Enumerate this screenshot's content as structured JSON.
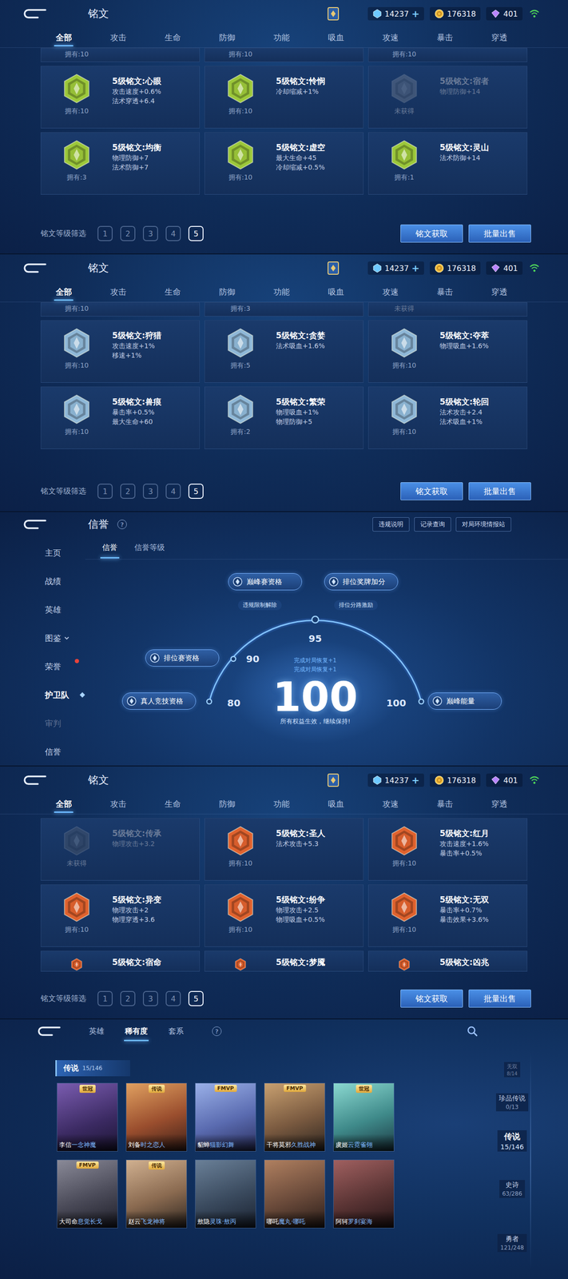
{
  "inscription_screen": {
    "title": "铭文",
    "currencies": [
      {
        "kind": "diamond",
        "value": "14237",
        "add": "+"
      },
      {
        "kind": "coin",
        "value": "176318"
      },
      {
        "kind": "gem",
        "value": "401"
      }
    ],
    "tabs": [
      {
        "label": "全部",
        "selected": true
      },
      {
        "label": "攻击",
        "selected": false
      },
      {
        "label": "生命",
        "selected": false
      },
      {
        "label": "防御",
        "selected": false
      },
      {
        "label": "功能",
        "selected": false
      },
      {
        "label": "吸血",
        "selected": false
      },
      {
        "label": "攻速",
        "selected": false
      },
      {
        "label": "暴击",
        "selected": false
      },
      {
        "label": "穿透",
        "selected": false
      }
    ],
    "filter_label": "铭文等级筛选",
    "levels": [
      {
        "label": "1",
        "selected": false
      },
      {
        "label": "2",
        "selected": false
      },
      {
        "label": "3",
        "selected": false
      },
      {
        "label": "4",
        "selected": false
      },
      {
        "label": "5",
        "selected": true
      }
    ],
    "buttons": [
      "铭文获取",
      "批量出售"
    ]
  },
  "inscription_pages": [
    {
      "rows": [
        {
          "kind": "cut-top",
          "cards": [
            {
              "owned": true,
              "owned_text": "拥有:10"
            },
            {
              "owned": true,
              "owned_text": "拥有:10"
            },
            {
              "owned": true,
              "owned_text": "拥有:10"
            }
          ]
        },
        {
          "kind": "full",
          "cards": [
            {
              "name": "5级铭文:心眼",
              "stats": [
                "攻击速度+0.6%",
                "法术穿透+6.4"
              ],
              "owned": true,
              "owned_text": "拥有:10",
              "color": "#9cc83a"
            },
            {
              "name": "5级铭文:怜悯",
              "stats": [
                "冷却缩减+1%"
              ],
              "owned": true,
              "owned_text": "拥有:10",
              "color": "#9cc83a"
            },
            {
              "name": "5级铭文:宿者",
              "stats": [
                "物理防御+14"
              ],
              "owned": false,
              "owned_text": "未获得",
              "color": "#9cc83a"
            }
          ]
        },
        {
          "kind": "full",
          "cards": [
            {
              "name": "5级铭文:均衡",
              "stats": [
                "物理防御+7",
                "法术防御+7"
              ],
              "owned": true,
              "owned_text": "拥有:3",
              "color": "#9cc83a"
            },
            {
              "name": "5级铭文:虚空",
              "stats": [
                "最大生命+45",
                "冷却缩减+0.5%"
              ],
              "owned": true,
              "owned_text": "拥有:10",
              "color": "#9cc83a"
            },
            {
              "name": "5级铭文:灵山",
              "stats": [
                "法术防御+14"
              ],
              "owned": true,
              "owned_text": "拥有:1",
              "color": "#9cc83a"
            }
          ]
        }
      ]
    },
    {
      "rows": [
        {
          "kind": "cut-top",
          "cards": [
            {
              "owned": true,
              "owned_text": "拥有:10"
            },
            {
              "owned": true,
              "owned_text": "拥有:3"
            },
            {
              "owned": false,
              "owned_text": "未获得"
            }
          ]
        },
        {
          "kind": "full",
          "cards": [
            {
              "name": "5级铭文:狩猎",
              "stats": [
                "攻击速度+1%",
                "移速+1%"
              ],
              "owned": true,
              "owned_text": "拥有:10",
              "color": "#8fb8d8"
            },
            {
              "name": "5级铭文:贪婪",
              "stats": [
                "法术吸血+1.6%"
              ],
              "owned": true,
              "owned_text": "拥有:5",
              "color": "#8fb8d8"
            },
            {
              "name": "5级铭文:夺萃",
              "stats": [
                "物理吸血+1.6%"
              ],
              "owned": true,
              "owned_text": "拥有:10",
              "color": "#8fb8d8"
            }
          ]
        },
        {
          "kind": "full",
          "cards": [
            {
              "name": "5级铭文:兽痕",
              "stats": [
                "暴击率+0.5%",
                "最大生命+60"
              ],
              "owned": true,
              "owned_text": "拥有:10",
              "color": "#8fb8d8"
            },
            {
              "name": "5级铭文:繁荣",
              "stats": [
                "物理吸血+1%",
                "物理防御+5"
              ],
              "owned": true,
              "owned_text": "拥有:2",
              "color": "#8fb8d8"
            },
            {
              "name": "5级铭文:轮回",
              "stats": [
                "法术攻击+2.4",
                "法术吸血+1%"
              ],
              "owned": true,
              "owned_text": "拥有:10",
              "color": "#8fb8d8"
            }
          ]
        }
      ]
    },
    {
      "rows": [
        {
          "kind": "full",
          "cards": [
            {
              "name": "5级铭文:传承",
              "stats": [
                "物理攻击+3.2"
              ],
              "owned": false,
              "owned_text": "未获得",
              "color": "#e0622e"
            },
            {
              "name": "5级铭文:圣人",
              "stats": [
                "法术攻击+5.3"
              ],
              "owned": true,
              "owned_text": "拥有:10",
              "color": "#e0622e"
            },
            {
              "name": "5级铭文:红月",
              "stats": [
                "攻击速度+1.6%",
                "暴击率+0.5%"
              ],
              "owned": true,
              "owned_text": "拥有:10",
              "color": "#e0622e"
            }
          ]
        },
        {
          "kind": "full",
          "cards": [
            {
              "name": "5级铭文:异变",
              "stats": [
                "物理攻击+2",
                "物理穿透+3.6"
              ],
              "owned": true,
              "owned_text": "拥有:10",
              "color": "#e0622e"
            },
            {
              "name": "5级铭文:纷争",
              "stats": [
                "物理攻击+2.5",
                "物理吸血+0.5%"
              ],
              "owned": true,
              "owned_text": "拥有:10",
              "color": "#e0622e"
            },
            {
              "name": "5级铭文:无双",
              "stats": [
                "暴击率+0.7%",
                "暴击效果+3.6%"
              ],
              "owned": true,
              "owned_text": "拥有:10",
              "color": "#e0622e"
            }
          ]
        },
        {
          "kind": "cut-bottom",
          "cards": [
            {
              "name": "5级铭文:宿命",
              "owned": true,
              "color": "#e0622e"
            },
            {
              "name": "5级铭文:梦魇",
              "owned": true,
              "color": "#e0622e"
            },
            {
              "name": "5级铭文:凶兆",
              "owned": true,
              "color": "#e0622e"
            }
          ]
        }
      ]
    }
  ],
  "credit_screen": {
    "title": "信誉",
    "help": "?",
    "top_buttons": [
      "违规说明",
      "记录查询",
      "对局环境情报站"
    ],
    "sidebar": [
      {
        "label": "主页",
        "selected": false,
        "chevron": false,
        "badge": false,
        "dim": false
      },
      {
        "label": "战绩",
        "selected": false,
        "chevron": false,
        "badge": false,
        "dim": false
      },
      {
        "label": "英雄",
        "selected": false,
        "chevron": false,
        "badge": false,
        "dim": false
      },
      {
        "label": "图鉴",
        "selected": false,
        "chevron": true,
        "badge": false,
        "dim": false
      },
      {
        "label": "荣誉",
        "selected": false,
        "chevron": false,
        "badge": true,
        "dim": false
      },
      {
        "label": "护卫队",
        "selected": true,
        "chevron": false,
        "badge": false,
        "dim": false
      },
      {
        "label": "审判",
        "selected": false,
        "chevron": false,
        "badge": false,
        "dim": true
      },
      {
        "label": "信誉",
        "selected": false,
        "chevron": false,
        "badge": false,
        "dim": false
      }
    ],
    "tabs": [
      {
        "label": "信誉",
        "selected": true
      },
      {
        "label": "信誉等级",
        "selected": false
      }
    ],
    "score": "100",
    "level": 1.0,
    "message": "所有权益生效，继续保持!",
    "recovery": [
      "完成对局恢复+1",
      "完成对局恢复+1"
    ],
    "ticks": [
      "80",
      "90",
      "95",
      "100"
    ],
    "perks": [
      {
        "label": "巅峰赛资格",
        "note": "违规限制解除"
      },
      {
        "label": "排位奖牌加分",
        "note": "排位分路激励"
      },
      {
        "label": "排位赛资格"
      },
      {
        "label": "真人竞技资格"
      },
      {
        "label": "巅峰能量"
      }
    ]
  },
  "skin_screen": {
    "tabs": [
      {
        "label": "英雄",
        "selected": false
      },
      {
        "label": "稀有度",
        "selected": true
      },
      {
        "label": "套系",
        "selected": false
      }
    ],
    "help": "?",
    "section": {
      "label": "传说",
      "count": "15/146"
    },
    "cards": [
      {
        "hero": "李信",
        "skin": "一念神魔",
        "tag": "世冠"
      },
      {
        "hero": "刘备",
        "skin": "时之恋人",
        "tag": "传说"
      },
      {
        "hero": "貂蝉",
        "skin": "猫影幻舞",
        "tag": "FMVP"
      },
      {
        "hero": "干将莫邪",
        "skin": "久胜战神",
        "tag": "FMVP"
      },
      {
        "hero": "虞姬",
        "skin": "云霓雀翎",
        "tag": "世冠"
      },
      {
        "hero": "大司命",
        "skin": "息觉长戈",
        "tag": "FMVP"
      },
      {
        "hero": "赵云",
        "skin": "飞龙神将",
        "tag": "传说"
      },
      {
        "hero": "敖隐",
        "skin": "灵珠·敖丙",
        "tag": ""
      },
      {
        "hero": "哪吒",
        "skin": "魔丸·哪吒",
        "tag": ""
      },
      {
        "hero": "阿轲",
        "skin": "罗刹宴海",
        "tag": ""
      }
    ],
    "rarity_nav": [
      {
        "label": "无双",
        "count": "8/14",
        "selected": false
      },
      {
        "label": "珍品传说",
        "count": "0/13",
        "selected": false
      },
      {
        "label": "传说",
        "count": "15/146",
        "selected": true
      },
      {
        "label": "史诗",
        "count": "63/286",
        "selected": false
      },
      {
        "label": "勇者",
        "count": "121/248",
        "selected": false
      }
    ]
  }
}
